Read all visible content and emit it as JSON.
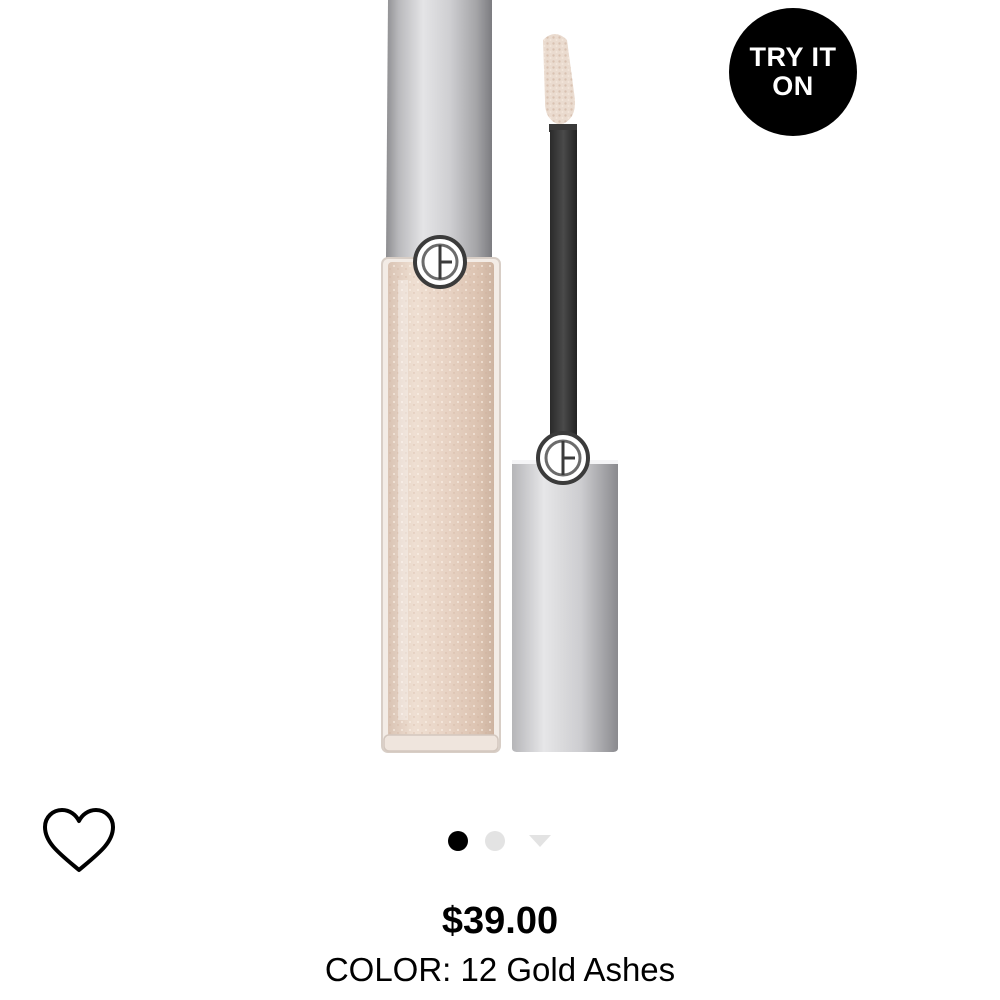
{
  "product": {
    "image_alt": "Eye Tint product image",
    "try_on_label": "TRY IT ON",
    "price": "$39.00",
    "color_prefix": "COLOR:",
    "color_name": "12 Gold Ashes",
    "color_line": "COLOR: 12 Gold Ashes"
  },
  "carousel": {
    "slide_count": 3,
    "active_index": 0
  },
  "icons": {
    "favorite": "heart-outline-icon",
    "video": "play-triangle-icon",
    "logo": "ga-monogram-icon"
  },
  "colors": {
    "badge": "#000000",
    "dot_active": "#000000",
    "dot_inactive": "#e3e3e3",
    "liquid": "#e9d6c6",
    "silver": "#c8c8ca"
  }
}
